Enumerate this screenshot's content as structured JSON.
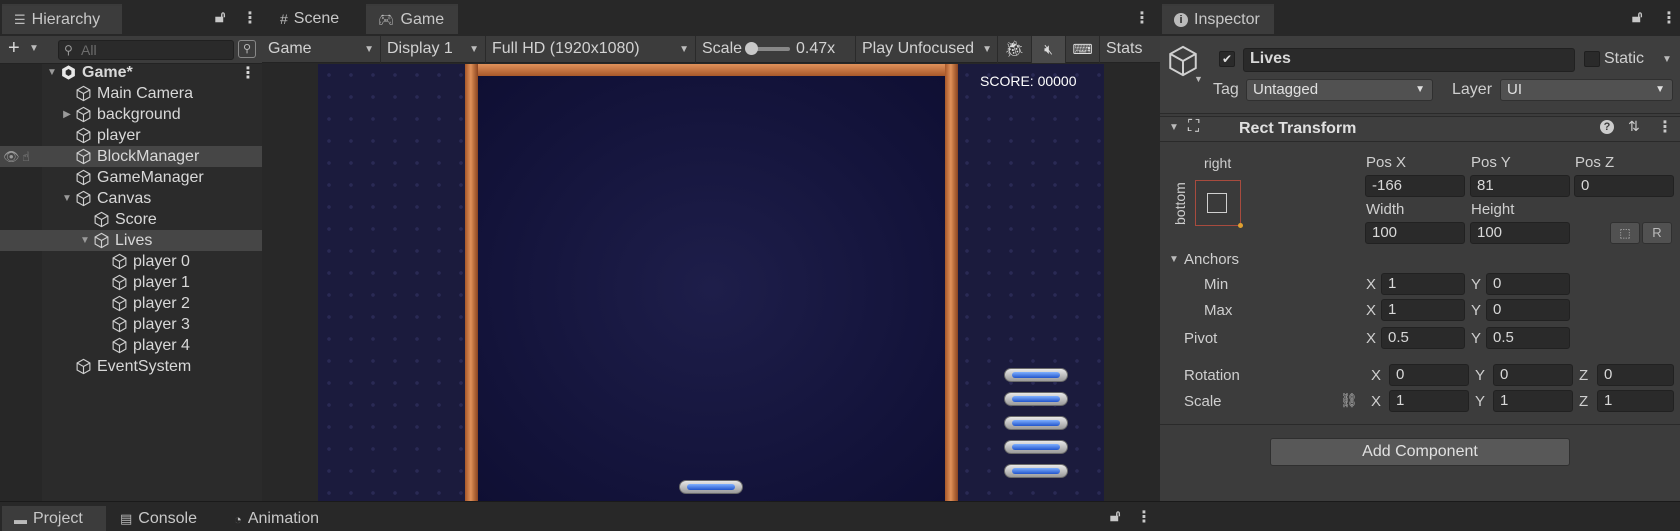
{
  "hierarchy": {
    "tab": "Hierarchy",
    "search_placeholder": "All",
    "items": [
      {
        "label": "Game*",
        "depth": 0,
        "expanded": true
      },
      {
        "label": "Main Camera",
        "depth": 1
      },
      {
        "label": "background",
        "depth": 1,
        "collapsed": true
      },
      {
        "label": "player",
        "depth": 1
      },
      {
        "label": "BlockManager",
        "depth": 1,
        "selected_row": true
      },
      {
        "label": "GameManager",
        "depth": 1
      },
      {
        "label": "Canvas",
        "depth": 1,
        "expanded": true
      },
      {
        "label": "Score",
        "depth": 2
      },
      {
        "label": "Lives",
        "depth": 2,
        "expanded": true,
        "selected": true
      },
      {
        "label": "player 0",
        "depth": 3
      },
      {
        "label": "player 1",
        "depth": 3
      },
      {
        "label": "player 2",
        "depth": 3
      },
      {
        "label": "player 3",
        "depth": 3
      },
      {
        "label": "player 4",
        "depth": 3
      },
      {
        "label": "EventSystem",
        "depth": 1
      }
    ]
  },
  "game": {
    "tabs": [
      "Scene",
      "Game"
    ],
    "active_tab": "Game",
    "toolbar": {
      "view_mode": "Game",
      "display": "Display 1",
      "resolution": "Full HD (1920x1080)",
      "scale_label": "Scale",
      "scale_value": "0.47x",
      "play_mode": "Play Unfocused",
      "stats": "Stats"
    },
    "score_text": "SCORE: 00000",
    "lives_count": 5
  },
  "inspector": {
    "tab": "Inspector",
    "object_name": "Lives",
    "active": true,
    "static_label": "Static",
    "tag_label": "Tag",
    "tag_value": "Untagged",
    "layer_label": "Layer",
    "layer_value": "UI",
    "component_title": "Rect Transform",
    "anchor_h": "right",
    "anchor_v": "bottom",
    "pos_x_label": "Pos X",
    "pos_y_label": "Pos Y",
    "pos_z_label": "Pos Z",
    "pos_x": "-166",
    "pos_y": "81",
    "pos_z": "0",
    "width_label": "Width",
    "height_label": "Height",
    "width": "100",
    "height": "100",
    "anchors_label": "Anchors",
    "min_label": "Min",
    "max_label": "Max",
    "pivot_label": "Pivot",
    "rotation_label": "Rotation",
    "scale_label": "Scale",
    "axis_x": "X",
    "axis_y": "Y",
    "axis_z": "Z",
    "anchor_min_x": "1",
    "anchor_min_y": "0",
    "anchor_max_x": "1",
    "anchor_max_y": "0",
    "pivot_x": "0.5",
    "pivot_y": "0.5",
    "rot_x": "0",
    "rot_y": "0",
    "rot_z": "0",
    "scale_x": "1",
    "scale_y": "1",
    "scale_z": "1",
    "add_component": "Add Component",
    "r_button": "R"
  },
  "bottom_tabs": [
    "Project",
    "Console",
    "Animation"
  ],
  "colors": {
    "panel_dark": "#282828",
    "panel": "#3c3c3c",
    "accent_border": "#d87a40",
    "life_blue": "#2255cc"
  }
}
